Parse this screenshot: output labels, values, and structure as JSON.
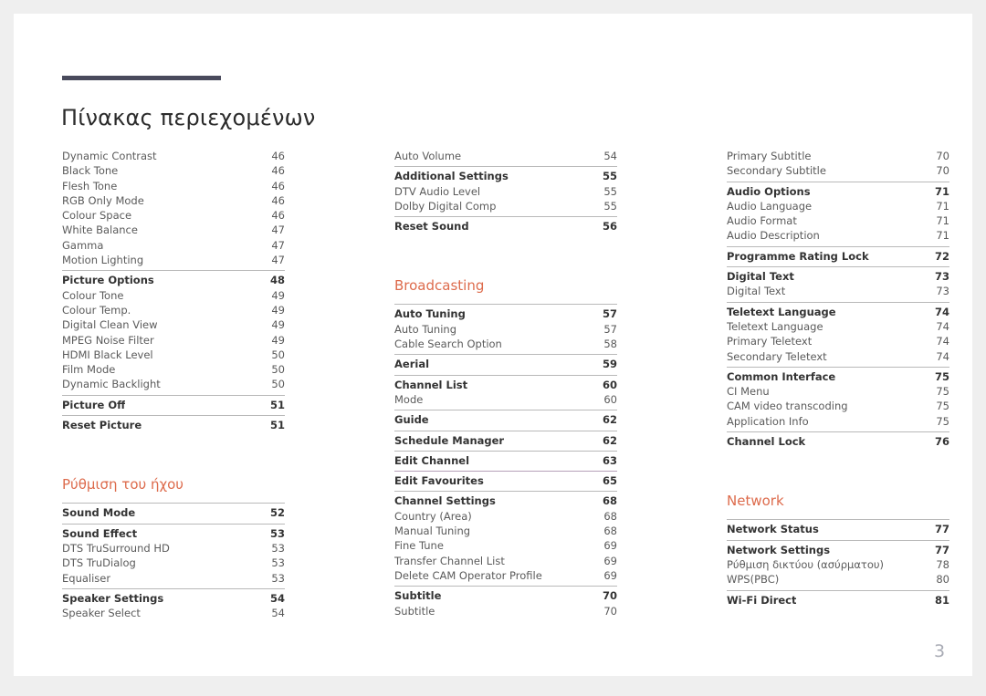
{
  "document": {
    "title": "Πίνακας περιεχομένων",
    "page_number": "3",
    "accent_color": "#dd6b4c",
    "rule_color": "#494a5c"
  },
  "columns": [
    {
      "id": "column-1",
      "blocks": [
        {
          "type": "group",
          "rule": "none",
          "rows": [
            {
              "label": "Dynamic Contrast",
              "page": "46",
              "level": 1
            },
            {
              "label": "Black Tone",
              "page": "46",
              "level": 1
            },
            {
              "label": "Flesh Tone",
              "page": "46",
              "level": 1
            },
            {
              "label": "RGB Only Mode",
              "page": "46",
              "level": 1
            },
            {
              "label": "Colour Space",
              "page": "46",
              "level": 1
            },
            {
              "label": "White Balance",
              "page": "47",
              "level": 1
            },
            {
              "label": "Gamma",
              "page": "47",
              "level": 1
            },
            {
              "label": "Motion Lighting",
              "page": "47",
              "level": 1
            }
          ]
        },
        {
          "type": "group",
          "rule": "solid",
          "rows": [
            {
              "label": "Picture Options",
              "page": "48",
              "level": 0
            },
            {
              "label": "Colour Tone",
              "page": "49",
              "level": 1
            },
            {
              "label": "Colour Temp.",
              "page": "49",
              "level": 1
            },
            {
              "label": "Digital Clean View",
              "page": "49",
              "level": 1
            },
            {
              "label": "MPEG Noise Filter",
              "page": "49",
              "level": 1
            },
            {
              "label": "HDMI Black Level",
              "page": "50",
              "level": 1
            },
            {
              "label": "Film Mode",
              "page": "50",
              "level": 1
            },
            {
              "label": "Dynamic Backlight",
              "page": "50",
              "level": 1
            }
          ]
        },
        {
          "type": "group",
          "rule": "solid",
          "rows": [
            {
              "label": "Picture Off",
              "page": "51",
              "level": 0
            }
          ]
        },
        {
          "type": "group",
          "rule": "solid",
          "rows": [
            {
              "label": "Reset Picture",
              "page": "51",
              "level": 0
            }
          ]
        },
        {
          "type": "spacer",
          "size": "lg"
        },
        {
          "type": "section",
          "label": "Ρύθμιση του ήχου"
        },
        {
          "type": "group",
          "rule": "solid",
          "rows": [
            {
              "label": "Sound Mode",
              "page": "52",
              "level": 0
            }
          ]
        },
        {
          "type": "group",
          "rule": "solid",
          "rows": [
            {
              "label": "Sound Effect",
              "page": "53",
              "level": 0
            },
            {
              "label": "DTS TruSurround HD",
              "page": "53",
              "level": 1
            },
            {
              "label": "DTS TruDialog",
              "page": "53",
              "level": 1
            },
            {
              "label": "Equaliser",
              "page": "53",
              "level": 1
            }
          ]
        },
        {
          "type": "group",
          "rule": "solid",
          "rows": [
            {
              "label": "Speaker Settings",
              "page": "54",
              "level": 0
            },
            {
              "label": "Speaker Select",
              "page": "54",
              "level": 1
            }
          ]
        }
      ]
    },
    {
      "id": "column-2",
      "blocks": [
        {
          "type": "group",
          "rule": "none",
          "rows": [
            {
              "label": "Auto Volume",
              "page": "54",
              "level": 1
            }
          ]
        },
        {
          "type": "group",
          "rule": "solid",
          "rows": [
            {
              "label": "Additional Settings",
              "page": "55",
              "level": 0
            },
            {
              "label": "DTV Audio Level",
              "page": "55",
              "level": 1
            },
            {
              "label": "Dolby Digital Comp",
              "page": "55",
              "level": 1
            }
          ]
        },
        {
          "type": "group",
          "rule": "solid",
          "rows": [
            {
              "label": "Reset Sound",
              "page": "56",
              "level": 0
            }
          ]
        },
        {
          "type": "spacer",
          "size": "lg"
        },
        {
          "type": "section",
          "label": "Broadcasting"
        },
        {
          "type": "group",
          "rule": "solid",
          "rows": [
            {
              "label": "Auto Tuning",
              "page": "57",
              "level": 0
            },
            {
              "label": "Auto Tuning",
              "page": "57",
              "level": 1
            },
            {
              "label": "Cable Search Option",
              "page": "58",
              "level": 1
            }
          ]
        },
        {
          "type": "group",
          "rule": "solid",
          "rows": [
            {
              "label": "Aerial",
              "page": "59",
              "level": 0
            }
          ]
        },
        {
          "type": "group",
          "rule": "solid",
          "rows": [
            {
              "label": "Channel List",
              "page": "60",
              "level": 0
            },
            {
              "label": "Mode",
              "page": "60",
              "level": 1
            }
          ]
        },
        {
          "type": "group",
          "rule": "solid",
          "rows": [
            {
              "label": "Guide",
              "page": "62",
              "level": 0
            }
          ]
        },
        {
          "type": "group",
          "rule": "solid",
          "rows": [
            {
              "label": "Schedule Manager",
              "page": "62",
              "level": 0
            }
          ]
        },
        {
          "type": "group",
          "rule": "solid",
          "rows": [
            {
              "label": "Edit Channel",
              "page": "63",
              "level": 0
            }
          ]
        },
        {
          "type": "group",
          "rule": "violet",
          "rows": [
            {
              "label": "Edit Favourites",
              "page": "65",
              "level": 0
            }
          ]
        },
        {
          "type": "group",
          "rule": "solid",
          "rows": [
            {
              "label": "Channel Settings",
              "page": "68",
              "level": 0
            },
            {
              "label": "Country (Area)",
              "page": "68",
              "level": 1
            },
            {
              "label": "Manual Tuning",
              "page": "68",
              "level": 1
            },
            {
              "label": "Fine Tune",
              "page": "69",
              "level": 1
            },
            {
              "label": "Transfer Channel List",
              "page": "69",
              "level": 1
            },
            {
              "label": "Delete CAM Operator Profile",
              "page": "69",
              "level": 1
            }
          ]
        },
        {
          "type": "group",
          "rule": "solid",
          "rows": [
            {
              "label": "Subtitle",
              "page": "70",
              "level": 0
            },
            {
              "label": "Subtitle",
              "page": "70",
              "level": 1
            }
          ]
        }
      ]
    },
    {
      "id": "column-3",
      "blocks": [
        {
          "type": "group",
          "rule": "none",
          "rows": [
            {
              "label": "Primary Subtitle",
              "page": "70",
              "level": 1
            },
            {
              "label": "Secondary Subtitle",
              "page": "70",
              "level": 1
            }
          ]
        },
        {
          "type": "group",
          "rule": "solid",
          "rows": [
            {
              "label": "Audio Options",
              "page": "71",
              "level": 0
            },
            {
              "label": "Audio Language",
              "page": "71",
              "level": 1
            },
            {
              "label": "Audio Format",
              "page": "71",
              "level": 1
            },
            {
              "label": "Audio Description",
              "page": "71",
              "level": 1
            }
          ]
        },
        {
          "type": "group",
          "rule": "solid",
          "rows": [
            {
              "label": "Programme Rating Lock",
              "page": "72",
              "level": 0
            }
          ]
        },
        {
          "type": "group",
          "rule": "solid",
          "rows": [
            {
              "label": "Digital Text",
              "page": "73",
              "level": 0
            },
            {
              "label": "Digital Text",
              "page": "73",
              "level": 1
            }
          ]
        },
        {
          "type": "group",
          "rule": "solid",
          "rows": [
            {
              "label": "Teletext Language",
              "page": "74",
              "level": 0
            },
            {
              "label": "Teletext Language",
              "page": "74",
              "level": 1
            },
            {
              "label": "Primary Teletext",
              "page": "74",
              "level": 1
            },
            {
              "label": "Secondary Teletext",
              "page": "74",
              "level": 1
            }
          ]
        },
        {
          "type": "group",
          "rule": "solid",
          "rows": [
            {
              "label": "Common Interface",
              "page": "75",
              "level": 0
            },
            {
              "label": "CI Menu",
              "page": "75",
              "level": 1
            },
            {
              "label": "CAM video transcoding",
              "page": "75",
              "level": 1
            },
            {
              "label": "Application Info",
              "page": "75",
              "level": 1
            }
          ]
        },
        {
          "type": "group",
          "rule": "solid",
          "rows": [
            {
              "label": "Channel Lock",
              "page": "76",
              "level": 0
            }
          ]
        },
        {
          "type": "spacer",
          "size": "lg"
        },
        {
          "type": "section",
          "label": "Network"
        },
        {
          "type": "group",
          "rule": "solid",
          "rows": [
            {
              "label": "Network Status",
              "page": "77",
              "level": 0
            }
          ]
        },
        {
          "type": "group",
          "rule": "solid",
          "rows": [
            {
              "label": "Network Settings",
              "page": "77",
              "level": 0
            },
            {
              "label": "Ρύθμιση δικτύου (ασύρματου)",
              "page": "78",
              "level": 1
            },
            {
              "label": "WPS(PBC)",
              "page": "80",
              "level": 1
            }
          ]
        },
        {
          "type": "group",
          "rule": "solid",
          "rows": [
            {
              "label": "Wi-Fi Direct",
              "page": "81",
              "level": 0
            }
          ]
        }
      ]
    }
  ]
}
